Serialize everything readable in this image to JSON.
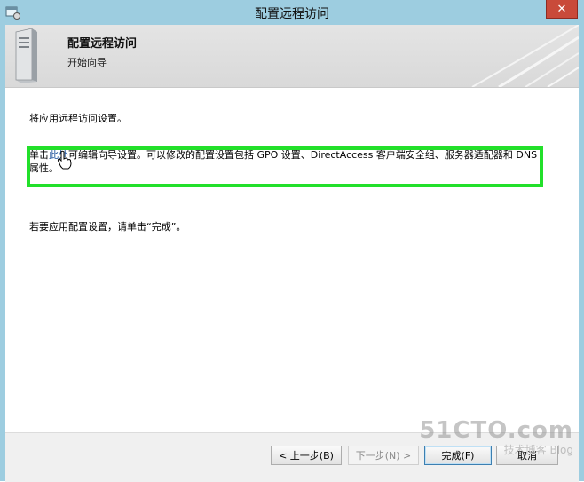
{
  "window": {
    "title": "配置远程访问",
    "close_glyph": "✕",
    "icon": "app-window-icon"
  },
  "header": {
    "title": "配置远程访问",
    "subtitle": "开始向导",
    "icon": "server-icon"
  },
  "body": {
    "intro": "将应用远程访问设置。",
    "edit_prefix": "单击",
    "edit_link": "此处",
    "edit_suffix": "可编辑向导设置。可以修改的配置设置包括 GPO 设置、DirectAccess 客户端安全组、服务器适配器和 DNS 属性。",
    "apply_hint": "若要应用配置设置，请单击“完成”。",
    "highlight_color": "#22e02a"
  },
  "buttons": {
    "back": "< 上一步(B)",
    "next": "下一步(N) >",
    "finish": "完成(F)",
    "cancel": "取消"
  },
  "watermark": {
    "main": "51CTO.com",
    "sub": "技术博客 Blog"
  }
}
